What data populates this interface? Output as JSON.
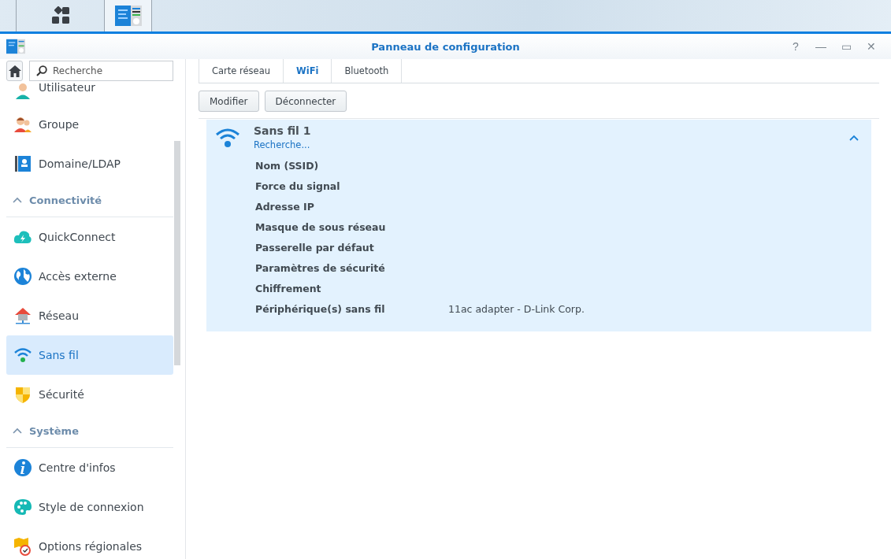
{
  "window": {
    "title": "Panneau de configuration",
    "controls": [
      "?",
      "—",
      "▭",
      "✕"
    ]
  },
  "search": {
    "placeholder": "Recherche"
  },
  "sidebar": {
    "items": [
      {
        "kind": "item",
        "label": "Utilisateur",
        "selected": false
      },
      {
        "kind": "item",
        "label": "Groupe",
        "selected": false
      },
      {
        "kind": "item",
        "label": "Domaine/LDAP",
        "selected": false
      },
      {
        "kind": "header",
        "label": "Connectivité",
        "expanded": true
      },
      {
        "kind": "item",
        "label": "QuickConnect",
        "selected": false
      },
      {
        "kind": "item",
        "label": "Accès externe",
        "selected": false
      },
      {
        "kind": "item",
        "label": "Réseau",
        "selected": false
      },
      {
        "kind": "item",
        "label": "Sans fil",
        "selected": true
      },
      {
        "kind": "item",
        "label": "Sécurité",
        "selected": false
      },
      {
        "kind": "header",
        "label": "Système",
        "expanded": true
      },
      {
        "kind": "item",
        "label": "Centre d'infos",
        "selected": false
      },
      {
        "kind": "item",
        "label": "Style de connexion",
        "selected": false
      },
      {
        "kind": "item",
        "label": "Options régionales",
        "selected": false
      }
    ]
  },
  "tabs": [
    {
      "label": "Carte réseau",
      "selected": false
    },
    {
      "label": "WiFi",
      "selected": true
    },
    {
      "label": "Bluetooth",
      "selected": false
    }
  ],
  "buttons": [
    "Modifier",
    "Déconnecter"
  ],
  "connection": {
    "name": "Sans fil 1",
    "status": "Recherche...",
    "expanded": true,
    "fields": [
      {
        "label": "Nom (SSID)"
      },
      {
        "label": "Force du signal"
      },
      {
        "label": "Adresse IP"
      },
      {
        "label": "Masque de sous réseau"
      },
      {
        "label": "Passerelle par défaut"
      },
      {
        "label": "Paramètres de sécurité"
      },
      {
        "label": "Chiffrement"
      },
      {
        "label": "Périphérique(s) sans fil",
        "value": "11ac adapter - D-Link Corp."
      }
    ]
  }
}
